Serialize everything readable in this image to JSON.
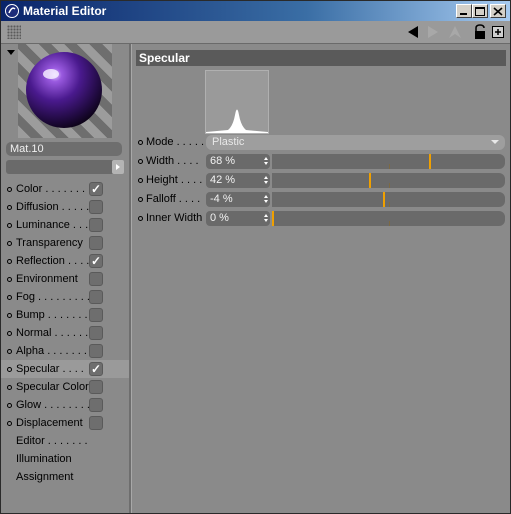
{
  "window": {
    "title": "Material Editor"
  },
  "colors": {
    "slider_marker": "#f0a000",
    "title_bar": "#0a246a"
  },
  "material": {
    "name": "Mat.10"
  },
  "channels": [
    {
      "label": "Color . . . . . . . .",
      "checked": true,
      "bullet": true
    },
    {
      "label": "Diffusion . . . . .",
      "checked": false,
      "bullet": true
    },
    {
      "label": "Luminance . . .",
      "checked": false,
      "bullet": true
    },
    {
      "label": "Transparency",
      "checked": false,
      "bullet": true
    },
    {
      "label": "Reflection . . . .",
      "checked": true,
      "bullet": true
    },
    {
      "label": "Environment",
      "checked": false,
      "bullet": true
    },
    {
      "label": "Fog . . . . . . . . .",
      "checked": false,
      "bullet": true
    },
    {
      "label": "Bump . . . . . . . .",
      "checked": false,
      "bullet": true
    },
    {
      "label": "Normal . . . . . . .",
      "checked": false,
      "bullet": true
    },
    {
      "label": "Alpha . . . . . . . .",
      "checked": false,
      "bullet": true
    },
    {
      "label": "Specular . . . .",
      "checked": true,
      "bullet": true,
      "selected": true
    },
    {
      "label": "Specular Color",
      "checked": false,
      "bullet": true
    },
    {
      "label": "Glow . . . . . . . .",
      "checked": false,
      "bullet": true
    },
    {
      "label": "Displacement",
      "checked": false,
      "bullet": true
    },
    {
      "label": "Editor . . . . . . .",
      "checked": null,
      "bullet": false
    },
    {
      "label": "Illumination",
      "checked": null,
      "bullet": false
    },
    {
      "label": "Assignment",
      "checked": null,
      "bullet": false
    }
  ],
  "specular": {
    "title": "Specular",
    "mode": {
      "label": "Mode . . . . .",
      "value": "Plastic"
    },
    "params": [
      {
        "label": "Width . . . .",
        "value": "68 %",
        "fraction": 0.68
      },
      {
        "label": "Height . . . .",
        "value": "42 %",
        "fraction": 0.42
      },
      {
        "label": "Falloff . . . .",
        "value": "-4 %",
        "fraction": 0.48
      },
      {
        "label": "Inner Width",
        "value": "0 %",
        "fraction": 0.0
      }
    ]
  }
}
